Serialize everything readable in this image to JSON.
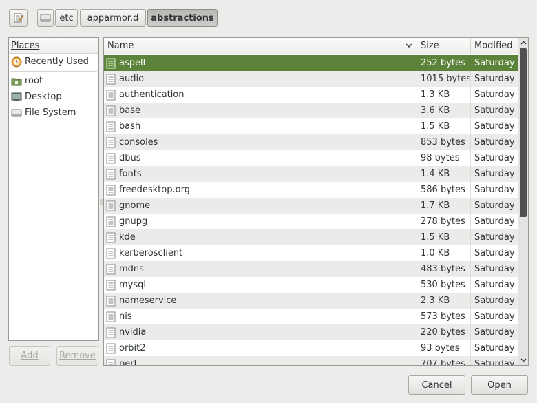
{
  "pathbar": {
    "crumbs": [
      "etc",
      "apparmor.d",
      "abstractions"
    ]
  },
  "places": {
    "header": "Places",
    "items": [
      {
        "label": "Recently Used",
        "icon": "recent-icon"
      },
      {
        "label": "root",
        "icon": "home-folder-icon"
      },
      {
        "label": "Desktop",
        "icon": "desktop-icon"
      },
      {
        "label": "File System",
        "icon": "drive-icon"
      }
    ],
    "add_label": "Add",
    "remove_label": "Remove"
  },
  "files": {
    "columns": {
      "name": "Name",
      "size": "Size",
      "modified": "Modified"
    },
    "rows": [
      {
        "name": "aspell",
        "size": "252 bytes",
        "modified": "Saturday",
        "selected": true
      },
      {
        "name": "audio",
        "size": "1015 bytes",
        "modified": "Saturday"
      },
      {
        "name": "authentication",
        "size": "1.3 KB",
        "modified": "Saturday"
      },
      {
        "name": "base",
        "size": "3.6 KB",
        "modified": "Saturday"
      },
      {
        "name": "bash",
        "size": "1.5 KB",
        "modified": "Saturday"
      },
      {
        "name": "consoles",
        "size": "853 bytes",
        "modified": "Saturday"
      },
      {
        "name": "dbus",
        "size": "98 bytes",
        "modified": "Saturday"
      },
      {
        "name": "fonts",
        "size": "1.4 KB",
        "modified": "Saturday"
      },
      {
        "name": "freedesktop.org",
        "size": "586 bytes",
        "modified": "Saturday"
      },
      {
        "name": "gnome",
        "size": "1.7 KB",
        "modified": "Saturday"
      },
      {
        "name": "gnupg",
        "size": "278 bytes",
        "modified": "Saturday"
      },
      {
        "name": "kde",
        "size": "1.5 KB",
        "modified": "Saturday"
      },
      {
        "name": "kerberosclient",
        "size": "1.0 KB",
        "modified": "Saturday"
      },
      {
        "name": "mdns",
        "size": "483 bytes",
        "modified": "Saturday"
      },
      {
        "name": "mysql",
        "size": "530 bytes",
        "modified": "Saturday"
      },
      {
        "name": "nameservice",
        "size": "2.3 KB",
        "modified": "Saturday"
      },
      {
        "name": "nis",
        "size": "573 bytes",
        "modified": "Saturday"
      },
      {
        "name": "nvidia",
        "size": "220 bytes",
        "modified": "Saturday"
      },
      {
        "name": "orbit2",
        "size": "93 bytes",
        "modified": "Saturday"
      },
      {
        "name": "perl",
        "size": "707 bytes",
        "modified": "Saturday"
      }
    ]
  },
  "actions": {
    "cancel_label": "Cancel",
    "open_label": "Open"
  },
  "colors": {
    "selection": "#5b843a",
    "window_bg": "#edeceb",
    "scroll_thumb": "#4f4f4f"
  }
}
